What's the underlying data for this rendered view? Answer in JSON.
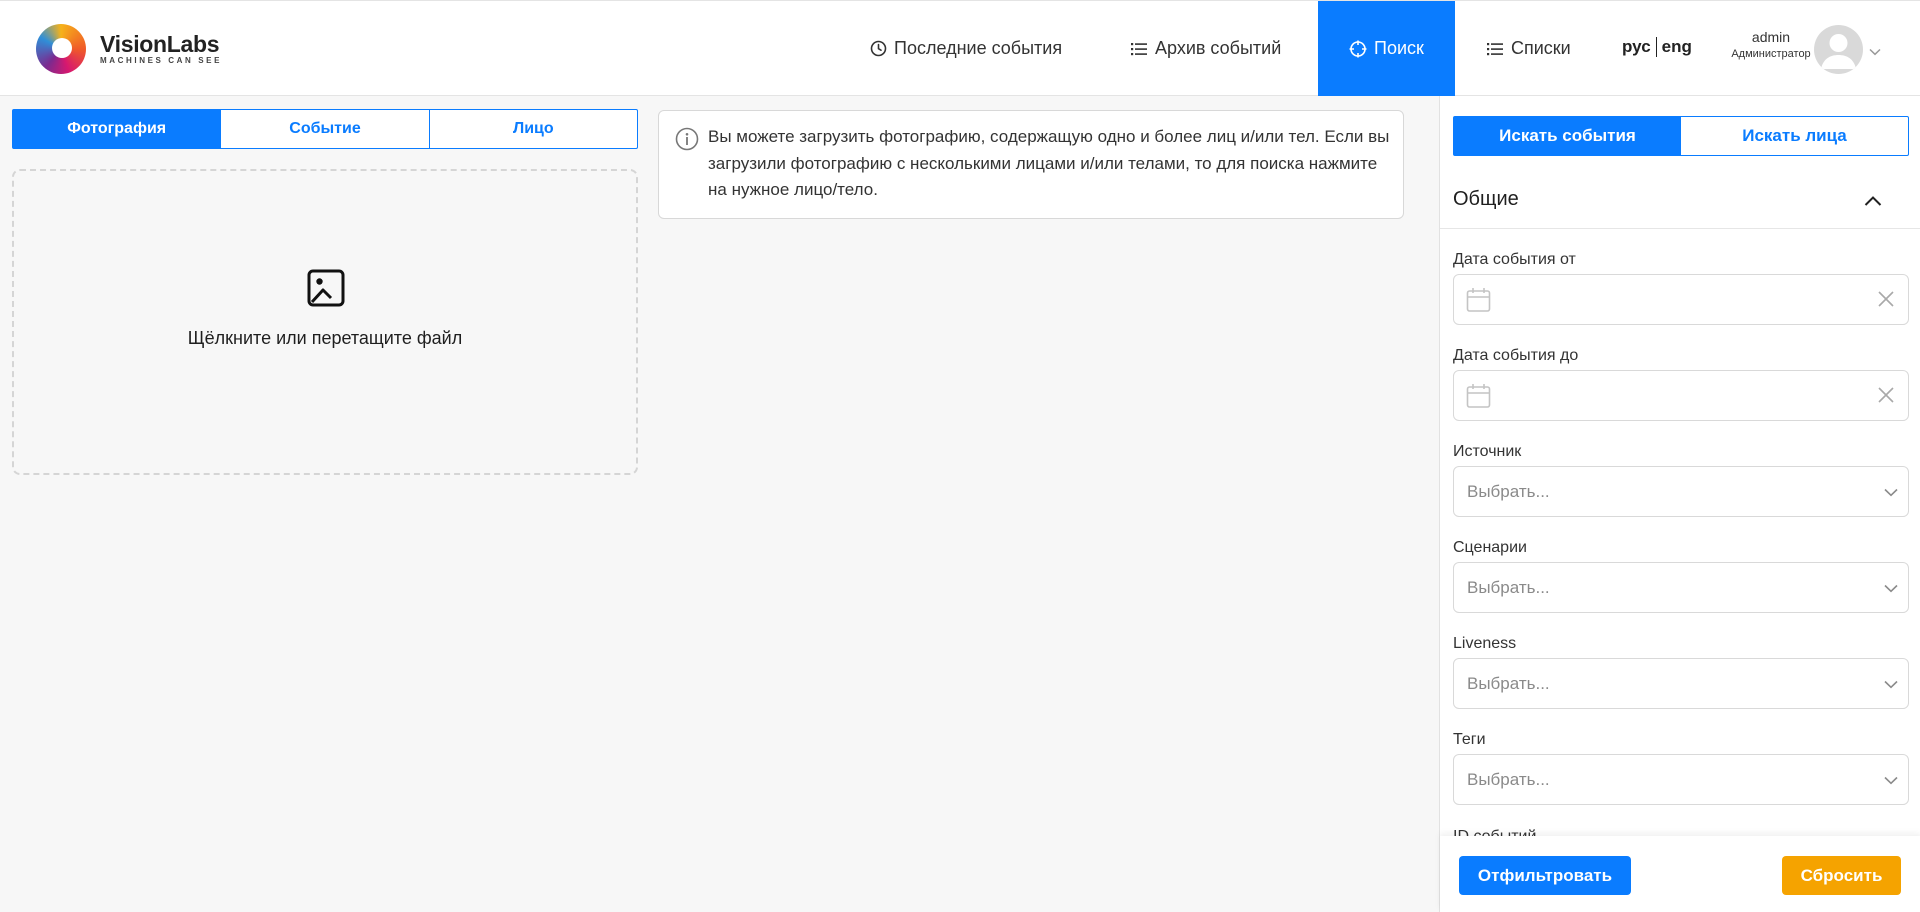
{
  "brand": {
    "name": "VisionLabs",
    "tagline": "MACHINES CAN SEE"
  },
  "nav": {
    "items": [
      {
        "label": "Последние события",
        "icon": "clock-icon"
      },
      {
        "label": "Архив событий",
        "icon": "list-icon"
      },
      {
        "label": "Поиск",
        "icon": "crosshair-icon",
        "active": true
      },
      {
        "label": "Списки",
        "icon": "list-icon"
      }
    ],
    "lang_ru": "рус",
    "lang_en": "eng"
  },
  "user": {
    "name": "admin",
    "role": "Администратор"
  },
  "search_source_tabs": {
    "photo": "Фотография",
    "event": "Событие",
    "face": "Лицо"
  },
  "dropzone": {
    "text": "Щёлкните или перетащите файл"
  },
  "info": {
    "text": "Вы можете загрузить фотографию, содержащую одно и более лиц и/или тел. Если вы загрузили фотографию с несколькими лицами и/или телами, то для поиска нажмите на нужное лицо/тело."
  },
  "panel": {
    "mode_tabs": {
      "events": "Искать события",
      "faces": "Искать лица"
    },
    "section_title": "Общие",
    "fields": {
      "date_from": "Дата события от",
      "date_to": "Дата события до",
      "source": "Источник",
      "scenarios": "Сценарии",
      "liveness": "Liveness",
      "tags": "Теги",
      "event_ids": "ID событий"
    },
    "select_placeholder": "Выбрать...",
    "buttons": {
      "filter": "Отфильтровать",
      "reset": "Сбросить"
    }
  },
  "colors": {
    "accent": "#0a7cff",
    "reset": "#f5a300"
  }
}
